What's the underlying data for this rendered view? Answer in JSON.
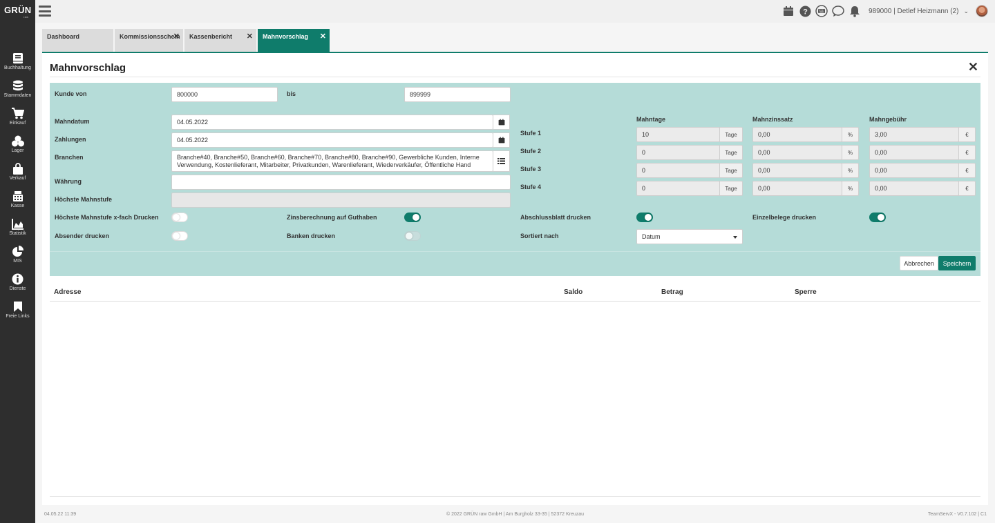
{
  "app": {
    "logo": "GRÜN",
    "logo_sub": "raw"
  },
  "sidebar": {
    "items": [
      {
        "label": "Buchhaltung",
        "icon": "book-icon"
      },
      {
        "label": "Stammdaten",
        "icon": "database-icon"
      },
      {
        "label": "Einkauf",
        "icon": "cart-icon"
      },
      {
        "label": "Lager",
        "icon": "boxes-icon"
      },
      {
        "label": "Verkauf",
        "icon": "bag-icon"
      },
      {
        "label": "Kasse",
        "icon": "register-icon"
      },
      {
        "label": "Statistik",
        "icon": "area-chart-icon"
      },
      {
        "label": "MIS",
        "icon": "pie-chart-icon"
      },
      {
        "label": "Dienste",
        "icon": "info-icon"
      },
      {
        "label": "Freie Links",
        "icon": "bookmark-icon"
      }
    ]
  },
  "topbar": {
    "user": "989000 | Detlef Heizmann (2)",
    "icons": [
      "calendar-icon",
      "help-icon",
      "keyboard-icon",
      "chat-icon",
      "bell-icon"
    ]
  },
  "tabs": [
    {
      "label": "Dashboard",
      "closable": false
    },
    {
      "label": "Kommissionsschein",
      "closable": true
    },
    {
      "label": "Kassenbericht",
      "closable": true
    },
    {
      "label": "Mahnvorschlag",
      "closable": true,
      "active": true
    }
  ],
  "page": {
    "title": "Mahnvorschlag"
  },
  "form": {
    "kunde_von_label": "Kunde von",
    "kunde_von": "800000",
    "bis_label": "bis",
    "bis": "899999",
    "mahndatum_label": "Mahndatum",
    "mahndatum": "04.05.2022",
    "zahlungen_label": "Zahlungen",
    "zahlungen": "04.05.2022",
    "branchen_label": "Branchen",
    "branchen": "Branche#40, Branche#50, Branche#60, Branche#70, Branche#80, Branche#90, Gewerbliche Kunden, Interne Verwendung, Kostenlieferant, Mitarbeiter, Privatkunden, Warenlieferant, Wiederverkäufer, Öffentliche Hand",
    "waehrung_label": "Währung",
    "waehrung": "",
    "hoechste_mahnstufe_label": "Höchste Mahnstufe",
    "hoechste_mahnstufe": "",
    "col_mahntage": "Mahntage",
    "col_mahnzinssatz": "Mahnzinssatz",
    "col_mahngebuehr": "Mahngebühr",
    "unit_tage": "Tage",
    "unit_percent": "%",
    "unit_euro": "€",
    "stufen": [
      {
        "label": "Stufe 1",
        "tage": "10",
        "zins": "0,00",
        "gebuehr": "3,00"
      },
      {
        "label": "Stufe 2",
        "tage": "0",
        "zins": "0,00",
        "gebuehr": "0,00"
      },
      {
        "label": "Stufe 3",
        "tage": "0",
        "zins": "0,00",
        "gebuehr": "0,00"
      },
      {
        "label": "Stufe 4",
        "tage": "0",
        "zins": "0,00",
        "gebuehr": "0,00"
      }
    ],
    "toggles": {
      "xfach_label": "Höchste Mahnstufe x-fach Drucken",
      "xfach": false,
      "zins_label": "Zinsberechnung auf Guthaben",
      "zins": true,
      "abschluss_label": "Abschlussblatt drucken",
      "abschluss": true,
      "einzel_label": "Einzelbelege drucken",
      "einzel": true,
      "absender_label": "Absender drucken",
      "absender": false,
      "banken_label": "Banken drucken",
      "banken": false
    },
    "sortiert_label": "Sortiert nach",
    "sortiert": "Datum",
    "cancel": "Abbrechen",
    "save": "Speichern"
  },
  "table": {
    "headers": [
      "Adresse",
      "Saldo",
      "Betrag",
      "Sperre"
    ]
  },
  "footer": {
    "left": "04.05.22 11:39",
    "center": "© 2022 GRÜN raw GmbH | Am Burgholz 33-35 | 52372 Kreuzau",
    "right": "TeamServX - V0.7.102 | C1"
  },
  "colors": {
    "accent": "#0f7c6b",
    "filter_bg": "#b5dcd8",
    "sidebar": "#2e2e2e"
  }
}
